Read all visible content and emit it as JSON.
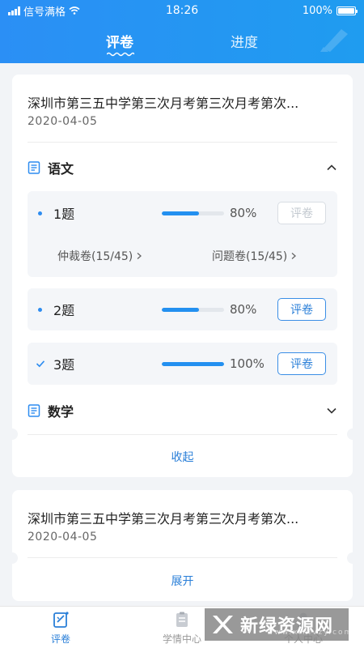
{
  "status_bar": {
    "carrier": "信号满格",
    "time": "18:26",
    "battery": "100%"
  },
  "tabs": [
    {
      "label": "评卷",
      "active": true
    },
    {
      "label": "进度",
      "active": false
    }
  ],
  "exams": [
    {
      "title": "深圳市第三五中学第三次月考第三次月考第次...",
      "date": "2020-04-05",
      "subjects": [
        {
          "name": "语文",
          "expanded": true,
          "questions": [
            {
              "label": "1题",
              "progress": 80,
              "progress_text": "80%",
              "action": "评卷",
              "action_enabled": false,
              "done": false,
              "links": [
                {
                  "label": "仲裁卷(15/45)"
                },
                {
                  "label": "问题卷(15/45)"
                }
              ]
            },
            {
              "label": "2题",
              "progress": 80,
              "progress_text": "80%",
              "action": "评卷",
              "action_enabled": true,
              "done": false
            },
            {
              "label": "3题",
              "progress": 100,
              "progress_text": "100%",
              "action": "评卷",
              "action_enabled": true,
              "done": true
            }
          ]
        },
        {
          "name": "数学",
          "expanded": false
        }
      ],
      "toggle_label": "收起"
    },
    {
      "title": "深圳市第三五中学第三次月考第三次月考第次...",
      "date": "2020-04-05",
      "toggle_label": "展开"
    }
  ],
  "bottom_nav": [
    {
      "label": "评卷",
      "icon": "grading-icon",
      "active": true
    },
    {
      "label": "学情中心",
      "icon": "clipboard-icon",
      "active": false
    },
    {
      "label": "个人中心",
      "icon": "person-icon",
      "active": false
    }
  ],
  "watermark": {
    "text": "新绿资源网",
    "url": "www.xinlvzy.com"
  },
  "colors": {
    "primary": "#2b8ff5",
    "accent_text": "#2a7fd8",
    "background": "#f2f4f7"
  }
}
